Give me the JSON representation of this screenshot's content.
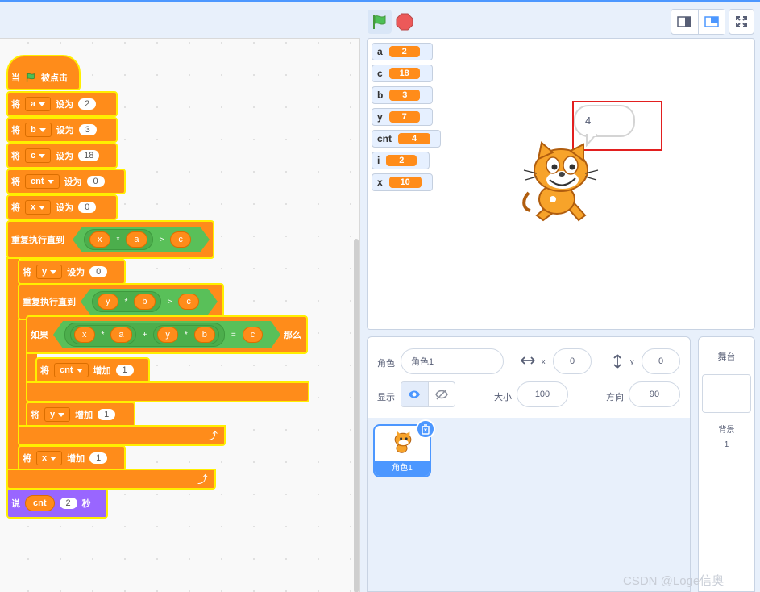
{
  "header": {
    "flag_icon": "green-flag-icon",
    "stop_icon": "stop-icon",
    "layout_small_icon": "small-stage-icon",
    "layout_normal_icon": "normal-stage-icon",
    "fullscreen_icon": "fullscreen-icon"
  },
  "script": {
    "hat": {
      "prefix": "当",
      "suffix": "被点击"
    },
    "set_a": {
      "verb": "将",
      "var": "a",
      "op": "设为",
      "value": "2"
    },
    "set_b": {
      "verb": "将",
      "var": "b",
      "op": "设为",
      "value": "3"
    },
    "set_c": {
      "verb": "将",
      "var": "c",
      "op": "设为",
      "value": "18"
    },
    "set_cnt": {
      "verb": "将",
      "var": "cnt",
      "op": "设为",
      "value": "0"
    },
    "set_x": {
      "verb": "将",
      "var": "x",
      "op": "设为",
      "value": "0"
    },
    "repeat1": {
      "label": "重复执行直到",
      "l": "x",
      "mul": "*",
      "r": "a",
      "cmp": ">",
      "rhs": "c"
    },
    "set_y": {
      "verb": "将",
      "var": "y",
      "op": "设为",
      "value": "0"
    },
    "repeat2": {
      "label": "重复执行直到",
      "l": "y",
      "mul": "*",
      "r": "b",
      "cmp": ">",
      "rhs": "c"
    },
    "if": {
      "label": "如果",
      "x": "x",
      "m1": "*",
      "a": "a",
      "plus": "+",
      "y": "y",
      "m2": "*",
      "b": "b",
      "eq": "=",
      "c": "c",
      "then": "那么"
    },
    "inc_cnt": {
      "verb": "将",
      "var": "cnt",
      "op": "增加",
      "value": "1"
    },
    "inc_y": {
      "verb": "将",
      "var": "y",
      "op": "增加",
      "value": "1"
    },
    "inc_x": {
      "verb": "将",
      "var": "x",
      "op": "增加",
      "value": "1"
    },
    "say": {
      "verb": "说",
      "var": "cnt",
      "value": "2",
      "unit": "秒"
    }
  },
  "stage": {
    "monitors": [
      {
        "name": "a",
        "value": "2"
      },
      {
        "name": "c",
        "value": "18"
      },
      {
        "name": "b",
        "value": "3"
      },
      {
        "name": "y",
        "value": "7"
      },
      {
        "name": "cnt",
        "value": "4"
      },
      {
        "name": "i",
        "value": "2"
      },
      {
        "name": "x",
        "value": "10"
      }
    ],
    "bubble_text": "4"
  },
  "sprite_info": {
    "sprite_label": "角色",
    "sprite_name": "角色1",
    "x_label": "x",
    "x_value": "0",
    "y_label": "y",
    "y_value": "0",
    "show_label": "显示",
    "size_label": "大小",
    "size_value": "100",
    "direction_label": "方向",
    "direction_value": "90"
  },
  "sprite_list": {
    "tile_name": "角色1"
  },
  "stage_panel": {
    "title": "舞台",
    "backdrops_label": "背景",
    "backdrops_count": "1"
  },
  "watermark": "CSDN @Loge信奥"
}
